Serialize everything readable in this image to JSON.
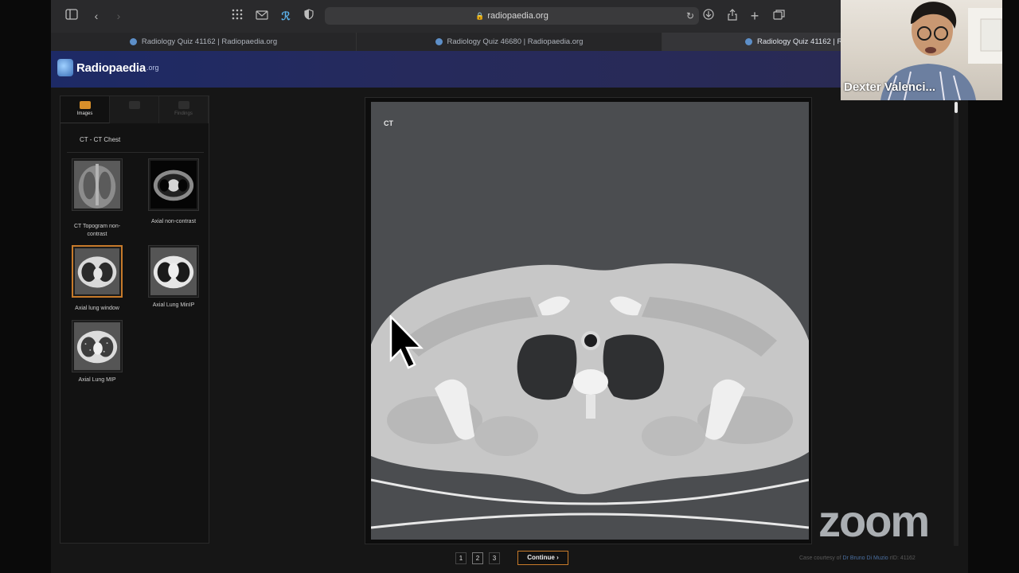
{
  "browser": {
    "url": "radiopaedia.org",
    "tabs": [
      {
        "title": "Radiology Quiz 41162 | Radiopaedia.org"
      },
      {
        "title": "Radiology Quiz 46680 | Radiopaedia.org"
      },
      {
        "title": "Radiology Quiz 41162 | Ra"
      }
    ]
  },
  "site": {
    "brand": "Radiopaedia",
    "brand_suffix": ".org"
  },
  "left_panel": {
    "tabs": [
      {
        "label": "Images"
      },
      {
        "label": ""
      },
      {
        "label": "Findings"
      }
    ],
    "series_title": "CT - CT Chest",
    "thumbnails": [
      {
        "label": "CT Topogram non-contrast"
      },
      {
        "label": "Axial non-contrast"
      },
      {
        "label": "Axial lung window"
      },
      {
        "label": "Axial Lung MinIP"
      },
      {
        "label": "Axial Lung MIP"
      }
    ]
  },
  "viewer": {
    "modality_label": "CT"
  },
  "pager": {
    "pages": [
      "1",
      "2",
      "3"
    ],
    "active_page": "2",
    "continue_label": "Continue",
    "continue_arrow": "›"
  },
  "footer": {
    "courtesy_prefix": "Case courtesy of",
    "courtesy_author": "Dr Bruno Di Muzio",
    "rid": "rID: 41162"
  },
  "video": {
    "participant_name": "Dexter Valenci..."
  },
  "watermark": "zoom"
}
